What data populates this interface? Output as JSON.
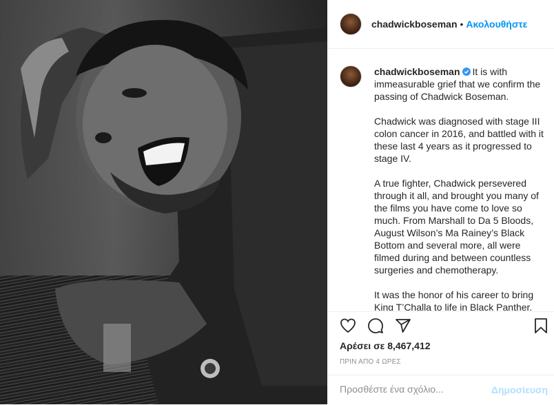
{
  "post": {
    "username": "chadwickboseman",
    "separator": "•",
    "follow_label": "Ακολουθήστε",
    "caption_text": "It is with immeasurable grief that we confirm the passing of Chadwick Boseman.\n\nChadwick was diagnosed with stage III colon cancer in 2016, and battled with it these last 4 years as it progressed to stage IV.\n\nA true fighter, Chadwick persevered through it all, and brought you many of the films you have come to love so much. From Marshall to Da 5 Bloods, August Wilson’s Ma Rainey’s Black Bottom and several more, all were filmed during and between countless surgeries and chemotherapy.\n\nIt was the honor of his career to bring King T’Challa to life in Black Panther.",
    "likes_text": "Αρέσει σε 8,467,412",
    "time_text": "ΠΡΙΝ ΑΠΟ 4 ΩΡΕΣ",
    "comment_placeholder": "Προσθέστε ένα σχόλιο...",
    "post_label": "Δημοσίευση"
  },
  "icons": {
    "like": "heart-icon",
    "comment": "comment-icon",
    "share": "share-icon",
    "save": "bookmark-icon",
    "verified": "verified-badge-icon"
  },
  "colors": {
    "accent": "#0095f6",
    "post_disabled": "#b2dffc",
    "muted": "#8e8e8e"
  }
}
